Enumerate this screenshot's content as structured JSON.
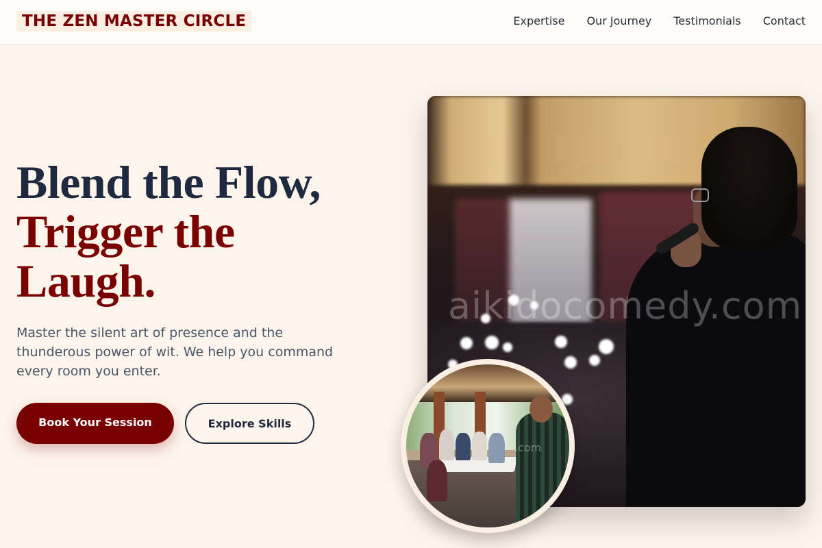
{
  "header": {
    "logo": "THE ZEN MASTER CIRCLE",
    "nav": [
      {
        "label": "Expertise"
      },
      {
        "label": "Our Journey"
      },
      {
        "label": "Testimonials"
      },
      {
        "label": "Contact"
      }
    ]
  },
  "hero": {
    "headline_line1": "Blend the Flow,",
    "headline_line2": "Trigger the Laugh.",
    "lead": "Master the silent art of presence and the thunderous power of wit. We help you command every room you enter.",
    "primary_button": "Book Your Session",
    "secondary_button": "Explore Skills"
  },
  "images": {
    "main_photo_watermark": "aikidocomedy.com",
    "circle_photo_watermark": ".com"
  },
  "colors": {
    "page_background": "#fdf4ec",
    "brand": "#7a0000",
    "heading_dark": "#1f2a40",
    "body_text": "#4a5568"
  }
}
